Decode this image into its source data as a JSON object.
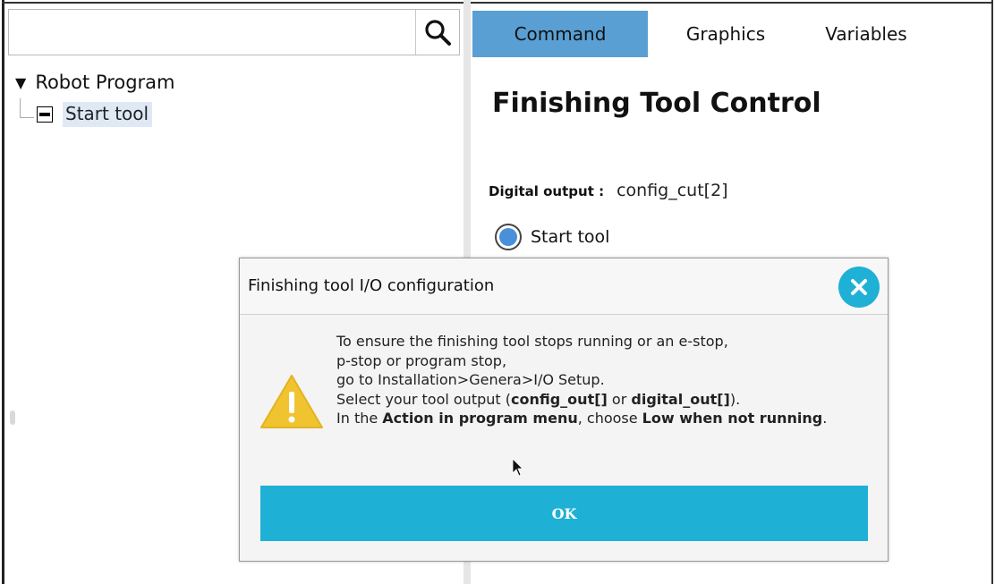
{
  "program_tree": {
    "search": {
      "value": "",
      "placeholder": ""
    },
    "root_label": "Robot Program",
    "root_toggle": "▼",
    "children": [
      {
        "label": "Start tool"
      }
    ]
  },
  "tabs": [
    {
      "label": "Command",
      "active": true
    },
    {
      "label": "Graphics",
      "active": false
    },
    {
      "label": "Variables",
      "active": false
    }
  ],
  "command_panel": {
    "title": "Finishing Tool Control",
    "digital_output_label": "Digital output :",
    "digital_output_value": "config_cut[2]",
    "radio_label": "Start tool",
    "radio_selected": true
  },
  "dialog": {
    "title": "Finishing tool I/O configuration",
    "message": {
      "line1": "To ensure the finishing tool stops running or an e-stop,",
      "line2": "p-stop or program stop,",
      "line3": "go to Installation>Genera>I/O Setup.",
      "line4_pre": "Select your tool output (",
      "line4_b1": "config_out[]",
      "line4_mid": " or ",
      "line4_b2": "digital_out[]",
      "line4_post": ").",
      "line5_pre": "In the ",
      "line5_b1": "Action in program menu",
      "line5_mid": ", choose ",
      "line5_b2": "Low when not running",
      "line5_post": "."
    },
    "ok_label": "OK"
  },
  "icons": {
    "search": "search-icon",
    "close": "close-icon",
    "warning": "warning-icon",
    "cursor": "mouse-cursor-icon"
  },
  "colors": {
    "active_tab": "#5a9fd3",
    "accent": "#1fb0d6",
    "selection": "#dfe9f5",
    "warning": "#f0c330",
    "radio": "#4a90d9"
  }
}
